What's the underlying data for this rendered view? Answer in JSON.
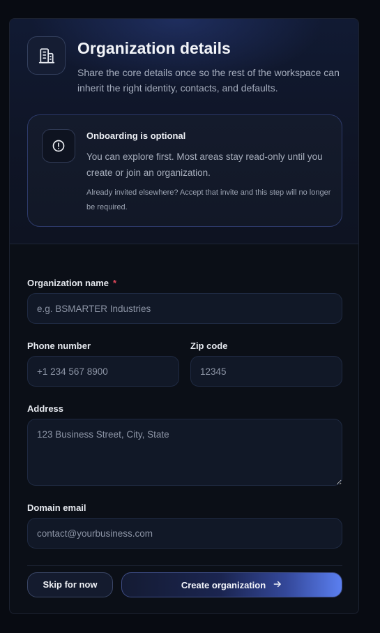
{
  "header": {
    "title": "Organization details",
    "subtitle": "Share the core details once so the rest of the workspace can inherit the right identity, contacts, and defaults.",
    "icon": "building-icon"
  },
  "notice": {
    "icon": "alert-circle-icon",
    "title": "Onboarding is optional",
    "body": "You can explore first. Most areas stay read-only until you create or join an organization.",
    "note": "Already invited elsewhere? Accept that invite and this step will no longer be required."
  },
  "form": {
    "org_name": {
      "label": "Organization name",
      "required_mark": "*",
      "placeholder": "e.g. BSMARTER Industries",
      "value": ""
    },
    "phone": {
      "label": "Phone number",
      "placeholder": "+1 234 567 8900",
      "value": ""
    },
    "zip": {
      "label": "Zip code",
      "placeholder": "12345",
      "value": ""
    },
    "address": {
      "label": "Address",
      "placeholder": "123 Business Street, City, State",
      "value": ""
    },
    "domain_email": {
      "label": "Domain email",
      "placeholder": "contact@yourbusiness.com",
      "value": ""
    }
  },
  "actions": {
    "skip_label": "Skip for now",
    "create_label": "Create organization",
    "create_icon": "arrow-right-icon"
  },
  "colors": {
    "background": "#080b12",
    "accent": "#5b7ff0",
    "required": "#e2485a"
  }
}
